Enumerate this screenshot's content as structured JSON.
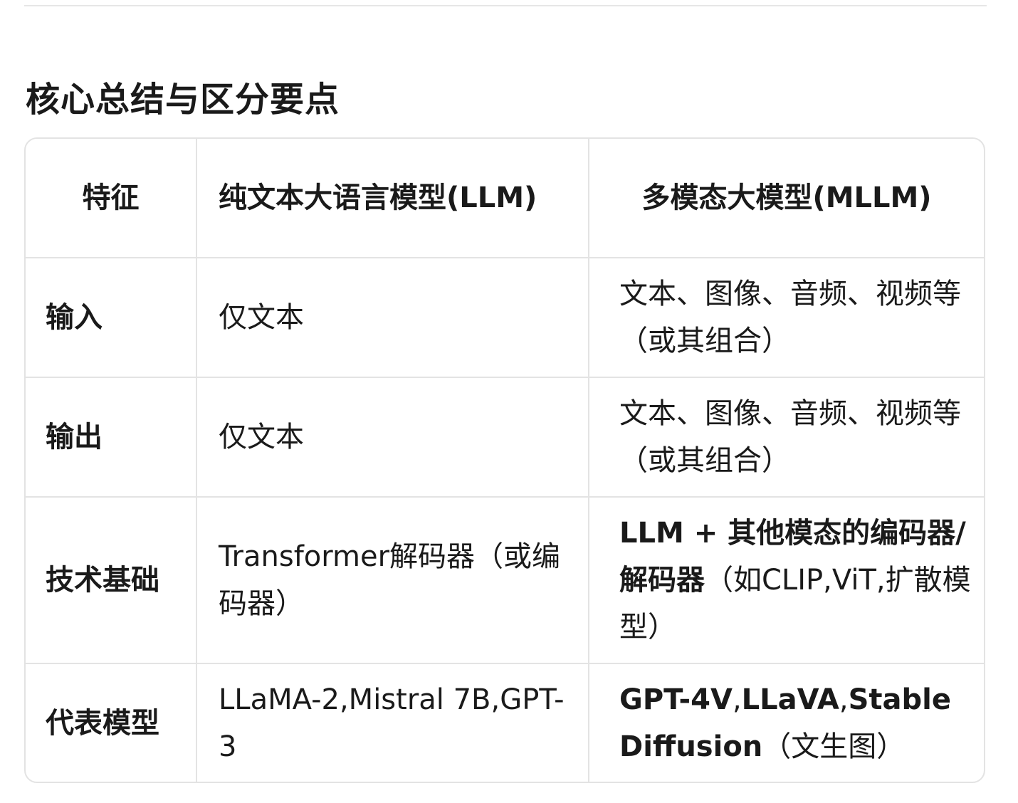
{
  "section": {
    "title": "核心总结与区分要点"
  },
  "table": {
    "headers": {
      "feature": "特征",
      "llm": "纯文本大语言模型(LLM)",
      "mllm": "多模态大模型(MLLM)"
    },
    "rows": [
      {
        "feature": "输入",
        "llm": "仅文本",
        "mllm": "文本、图像、音频、视频等（或其组合）"
      },
      {
        "feature": "输出",
        "llm": "仅文本",
        "mllm": "文本、图像、音频、视频等（或其组合）"
      },
      {
        "feature": "技术基础",
        "llm": "Transformer解码器（或编码器）",
        "mllm_bold": "LLM + 其他模态的编码器/解码器",
        "mllm_rest": "（如CLIP,ViT,扩散模型）"
      },
      {
        "feature": "代表模型",
        "llm": "LLaMA-2,Mistral 7B,GPT-3",
        "mllm_bold_1": "GPT-4V",
        "mllm_sep_1": ",",
        "mllm_bold_2": "LLaVA",
        "mllm_sep_2": ",",
        "mllm_bold_3": "Stable Diffusion",
        "mllm_rest": "（文生图）"
      }
    ]
  }
}
